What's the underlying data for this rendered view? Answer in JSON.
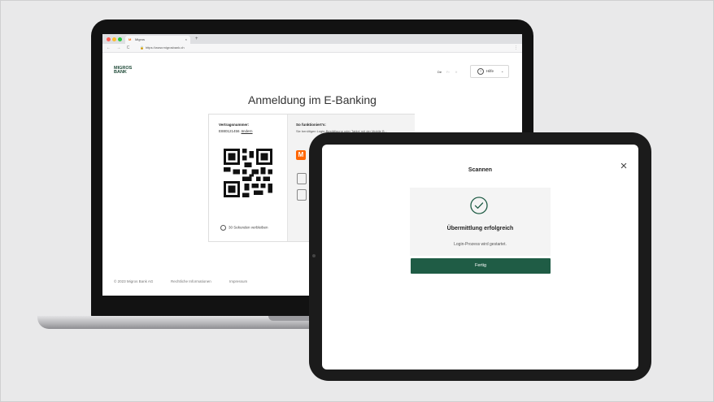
{
  "browser": {
    "tab_title": "Migros",
    "tab_favicon": "M",
    "tab_close": "×",
    "new_tab": "+",
    "url": "https://www.migrosbank.ch",
    "nav_icons": "← → C",
    "lock_icon": "🔒",
    "menu": "⋮"
  },
  "website": {
    "logo_line1": "MIGROS",
    "logo_line2": "BANK",
    "languages": [
      "De",
      "Fr",
      "It"
    ],
    "help_icon": "?",
    "help_label": "Hilfe",
    "help_chevron": "⌄",
    "title": "Anmeldung im E-Banking",
    "login_card": {
      "contract_label": "Vertragsnummer:",
      "contract_number": "E880121456",
      "change_link": "ändern",
      "timer_text": "30 Sekunden verbleiben",
      "how_title": "So funktioniert's:",
      "how_text": "Sie benötigen Login-Bestätigung oder Tablet mit der Mobile B...",
      "app_icon_letter": "M"
    },
    "footer": {
      "copyright": "© 2023 Migros Bank AG",
      "legal": "Rechtliche Informationen",
      "imprint": "Impressum"
    }
  },
  "modal": {
    "title": "Scannen",
    "close_icon": "×",
    "success_title": "Übermittlung erfolgreich",
    "success_message": "Login-Prozess wird gestartet.",
    "done_button": "Fertig"
  },
  "colors": {
    "brand_green": "#1f5c45",
    "migros_orange": "#ff6600"
  }
}
